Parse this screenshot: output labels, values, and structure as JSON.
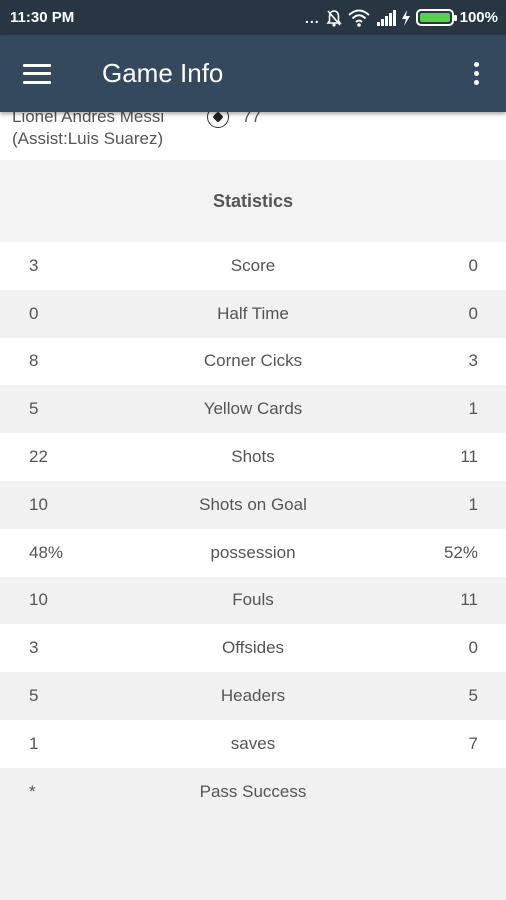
{
  "status_bar": {
    "time": "11:30 PM",
    "dots": "...",
    "battery": "100%",
    "icons": [
      "mute-icon",
      "wifi-icon",
      "signal-icon",
      "charging-icon",
      "battery-icon"
    ]
  },
  "app_bar": {
    "title": "Game Info",
    "menu_icon": "hamburger-icon",
    "more_icon": "more-vert-icon",
    "color": "#34495e"
  },
  "event": {
    "player": "Lionel Andres Messi",
    "assist": "(Assist:Luis Suarez)",
    "minute": "77",
    "icon": "soccer-ball-icon"
  },
  "statistics": {
    "title": "Statistics",
    "rows": [
      {
        "home": "3",
        "label": "Score",
        "away": "0"
      },
      {
        "home": "0",
        "label": "Half Time",
        "away": "0"
      },
      {
        "home": "8",
        "label": "Corner Cicks",
        "away": "3"
      },
      {
        "home": "5",
        "label": "Yellow Cards",
        "away": "1"
      },
      {
        "home": "22",
        "label": "Shots",
        "away": "11"
      },
      {
        "home": "10",
        "label": "Shots on Goal",
        "away": "1"
      },
      {
        "home": "48%",
        "label": "possession",
        "away": "52%"
      },
      {
        "home": "10",
        "label": "Fouls",
        "away": "11"
      },
      {
        "home": "3",
        "label": "Offsides",
        "away": "0"
      },
      {
        "home": "5",
        "label": "Headers",
        "away": "5"
      },
      {
        "home": "1",
        "label": "saves",
        "away": "7"
      },
      {
        "home": "*",
        "label": "Pass Success",
        "away": ""
      }
    ]
  }
}
